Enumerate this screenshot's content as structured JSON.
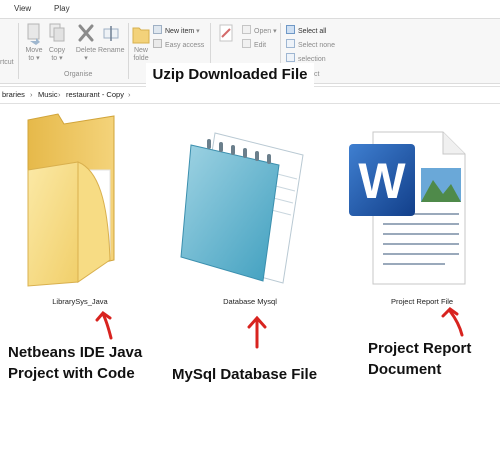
{
  "ribbon": {
    "tabs": [
      "View",
      "Play"
    ],
    "buttons": {
      "shortcut": "rtcut",
      "move_to": [
        "Move",
        "to"
      ],
      "copy_to": [
        "Copy",
        "to"
      ],
      "delete": "Delete",
      "rename": "Rename",
      "new_folder": [
        "New",
        "folde"
      ],
      "new_item": "New item",
      "easy_access": "Easy access",
      "open": "Open",
      "edit": "Edit",
      "select_all": "Select all",
      "select_none": "Select none",
      "invert_selection": "selection"
    },
    "groups": {
      "organise": "Organise",
      "select": "ct"
    }
  },
  "address_bar": {
    "path": [
      "braries",
      "Music",
      "restaurant - Copy"
    ],
    "separator": "›"
  },
  "overlay_title": "Uzip Downloaded File",
  "files": [
    {
      "name": "LibrarySys_Java",
      "icon": "folder-icon",
      "caption": [
        "Netbeans IDE Java",
        "Project with Code"
      ]
    },
    {
      "name": "Database Mysql",
      "icon": "notepad-text-file-icon",
      "caption": [
        "MySql Database File"
      ]
    },
    {
      "name": "Project Report File",
      "icon": "word-document-icon",
      "caption": [
        "Project Report",
        "Document"
      ]
    }
  ],
  "colors": {
    "arrow": "#d8231f",
    "folder": "#f5d36b",
    "word_blue": "#1e5fb4",
    "notepad_teal": "#6fbcd3"
  }
}
